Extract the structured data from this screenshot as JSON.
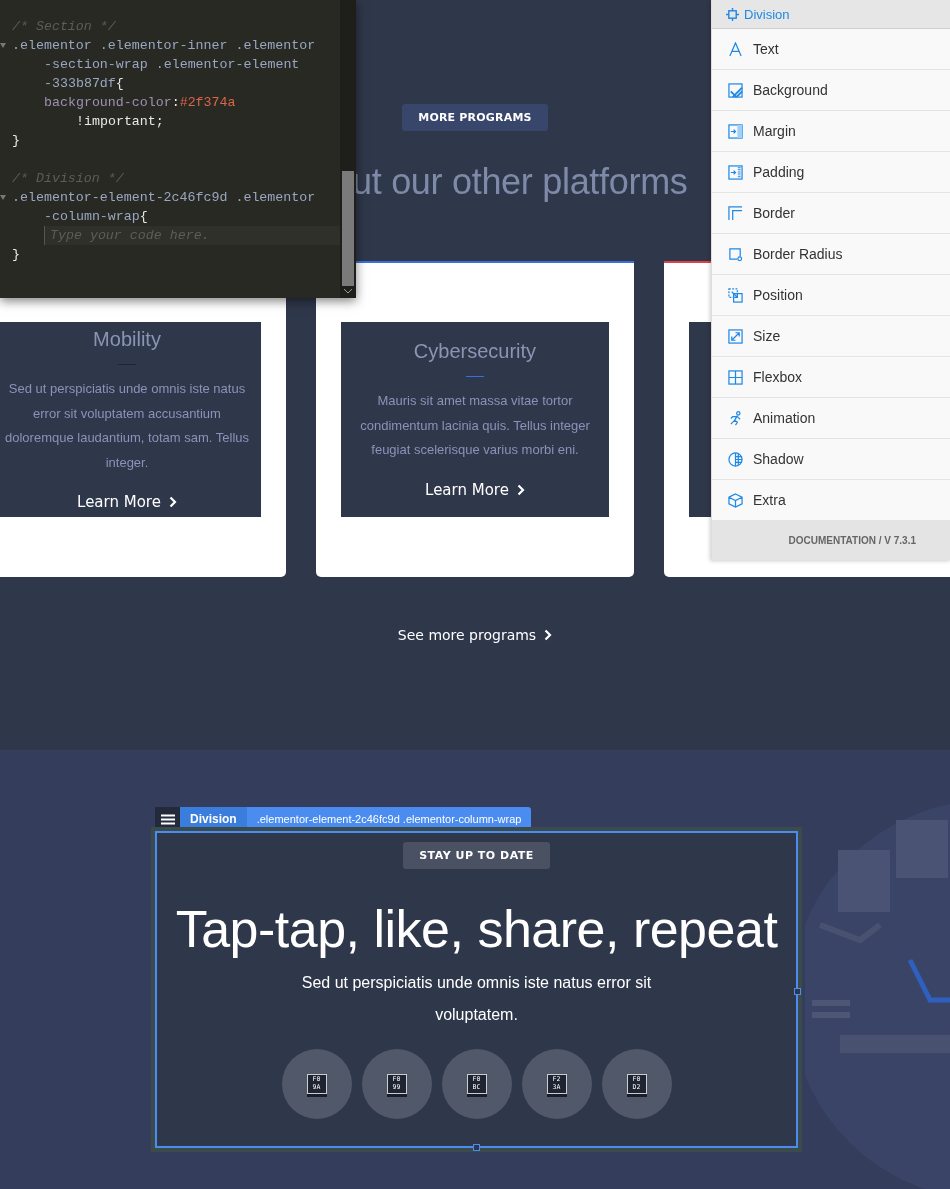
{
  "code_editor": {
    "lines": [
      {
        "kind": "comment",
        "text": "/* Section */"
      },
      {
        "kind": "selector",
        "text": ".elementor .elementor-inner .elementor"
      },
      {
        "kind": "wrap",
        "text": "-section-wrap .elementor-element"
      },
      {
        "kind": "wrap",
        "text": "-333b87df",
        "brace": "{"
      },
      {
        "kind": "declaration",
        "property": "background-color",
        "colon": ":",
        "value": "#2f374a"
      },
      {
        "kind": "important",
        "text": "!important;"
      },
      {
        "kind": "brace",
        "text": "}"
      },
      {
        "kind": "comment",
        "text": "/* Division */"
      },
      {
        "kind": "selector",
        "text": ".elementor-element-2c46fc9d .elementor"
      },
      {
        "kind": "wrap",
        "text": "-column-wrap",
        "brace": "{"
      },
      {
        "kind": "placeholder",
        "text": "Type your code here."
      },
      {
        "kind": "brace",
        "text": "}"
      }
    ]
  },
  "programs": {
    "badge": "MORE PROGRAMS",
    "heading": "ut our other platforms",
    "cards": [
      {
        "title": "Mobility",
        "text": "Sed ut perspiciatis unde omnis iste natus error sit voluptatem accusantium doloremque laudantium, totam sam. Tellus integer.",
        "link": "Learn More"
      },
      {
        "title": "Cybersecurity",
        "color": "#3b6fe0",
        "text": "Mauris sit amet massa vitae tortor condimentum lacinia quis. Tellus integer feugiat scelerisque varius morbi eni.",
        "link": "Learn More"
      },
      {
        "color": "#e0404a"
      }
    ],
    "more_link": "See more programs"
  },
  "style_panel": {
    "header": "Division",
    "items": [
      {
        "label": "Text"
      },
      {
        "label": "Background"
      },
      {
        "label": "Margin"
      },
      {
        "label": "Padding"
      },
      {
        "label": "Border"
      },
      {
        "label": "Border Radius"
      },
      {
        "label": "Position"
      },
      {
        "label": "Size"
      },
      {
        "label": "Flexbox"
      },
      {
        "label": "Animation"
      },
      {
        "label": "Shadow"
      },
      {
        "label": "Extra"
      }
    ],
    "footer": "DOCUMENTATION / V 7.3.1"
  },
  "newsletter": {
    "selection": {
      "type": "Division",
      "selector": ".elementor-element-2c46fc9d .elementor-column-wrap"
    },
    "badge": "STAY UP TO DATE",
    "heading": "Tap-tap, like, share, repeat",
    "text": "Sed ut perspiciatis unde omnis iste natus error sit voluptatem.",
    "social_buttons": [
      {
        "glyph": "F0 9A"
      },
      {
        "glyph": "F0 99"
      },
      {
        "glyph": "F0 BC"
      },
      {
        "glyph": "F2 3A"
      },
      {
        "glyph": "F0 D2"
      }
    ]
  }
}
